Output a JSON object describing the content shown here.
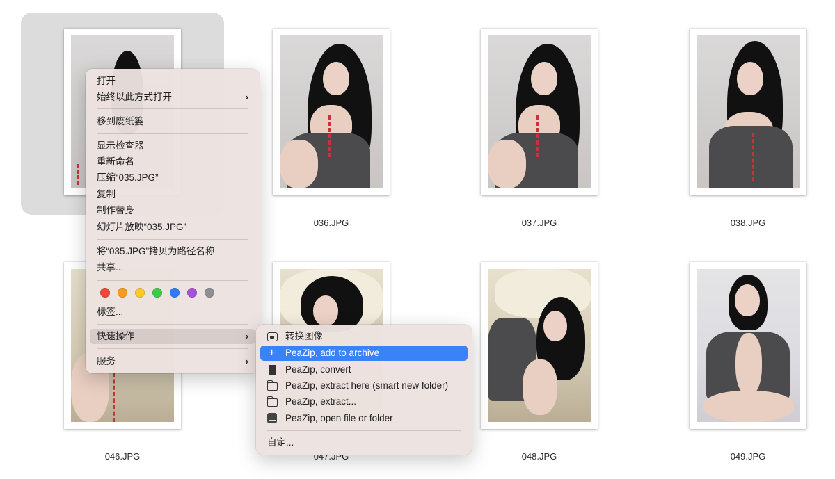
{
  "files": [
    {
      "name": "035.JPG",
      "selected": true
    },
    {
      "name": "036.JPG"
    },
    {
      "name": "037.JPG"
    },
    {
      "name": "038.JPG"
    },
    {
      "name": "046.JPG"
    },
    {
      "name": "047.JPG"
    },
    {
      "name": "048.JPG"
    },
    {
      "name": "049.JPG"
    }
  ],
  "context_menu": {
    "open": "打开",
    "always_open_with": "始终以此方式打开",
    "move_to_trash": "移到废纸篓",
    "show_inspector": "显示检查器",
    "rename": "重新命名",
    "compress": "压缩“035.JPG”",
    "duplicate": "复制",
    "make_alias": "制作替身",
    "slideshow": "幻灯片放映“035.JPG”",
    "copy_path": "将“035.JPG”拷贝为路径名称",
    "share": "共享...",
    "tag_colors": [
      "#f0453b",
      "#f59a23",
      "#f8c82d",
      "#3cc94c",
      "#2f7bf6",
      "#a552d8",
      "#8e8e93"
    ],
    "tags": "标签...",
    "quick_actions": "快速操作",
    "services": "服务"
  },
  "quick_actions_submenu": {
    "items": [
      {
        "label": "转换图像",
        "icon": "image-icon"
      },
      {
        "label": "PeaZip, add to archive",
        "icon": "plus-icon",
        "highlighted": true
      },
      {
        "label": "PeaZip, convert",
        "icon": "document-icon"
      },
      {
        "label": "PeaZip, extract here (smart new folder)",
        "icon": "folder-icon"
      },
      {
        "label": "PeaZip, extract...",
        "icon": "folder-icon"
      },
      {
        "label": "PeaZip, open file or folder",
        "icon": "drive-icon"
      }
    ],
    "customize": "自定..."
  },
  "colors": {
    "highlight": "#3a82f7",
    "selection_tile": "#dcdcdc"
  }
}
